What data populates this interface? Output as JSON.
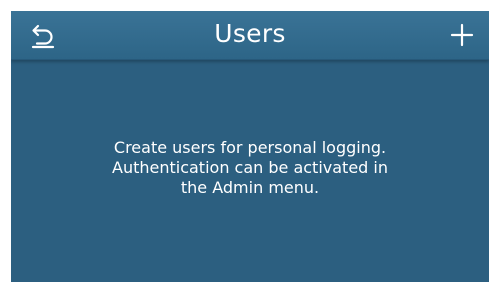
{
  "header": {
    "title": "Users",
    "back_icon": "back-arrow-icon",
    "add_icon": "plus-icon"
  },
  "main": {
    "message": "Create users for personal logging.\nAuthentication can be activated in\nthe Admin menu."
  },
  "colors": {
    "background": "#2c5f80",
    "header": "#3a7396",
    "text": "#ffffff"
  }
}
